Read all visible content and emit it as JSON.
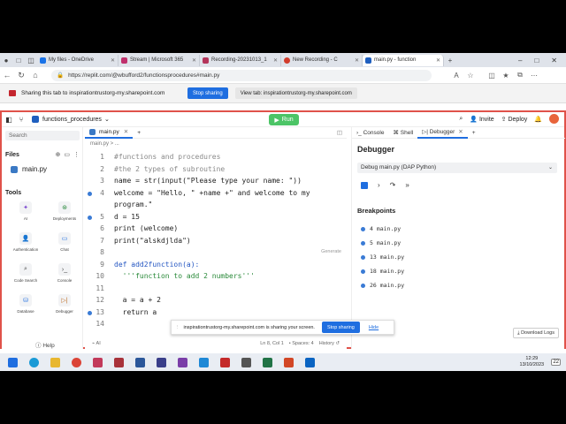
{
  "browser": {
    "tabs": [
      {
        "label": "My files - OneDrive",
        "color": "#1a73e8"
      },
      {
        "label": "Stream | Microsoft 365",
        "color": "#c0306c"
      },
      {
        "label": "Recording-20231013_1",
        "color": "#b4345a"
      },
      {
        "label": "New Recording - C",
        "color": "#d23c2c"
      },
      {
        "label": "main.py - function",
        "color": "#1f5fbf"
      }
    ],
    "url": "https://replit.com/@wbufford2/functionsprocedures#main.py"
  },
  "share_bar": {
    "message": "Sharing this tab to inspirationtrustorg-my.sharepoint.com",
    "stop_label": "Stop sharing",
    "view_label": "View tab: inspirationtrustorg-my.sharepoint.com"
  },
  "app": {
    "repo_name": "functions_procedures",
    "run_label": "Run",
    "invite_label": "Invite",
    "deploy_label": "Deploy",
    "search_placeholder": "Search",
    "files_label": "Files",
    "main_file": "main.py",
    "tools_label": "Tools",
    "tools": [
      "AI",
      "Deployments",
      "Authentication",
      "Chat",
      "Code Search",
      "Console",
      "Database",
      "Debugger"
    ],
    "help_label": "Help"
  },
  "editor": {
    "tab": "main.py",
    "breadcrumb": "main.py > ...",
    "generate_hint": "Generate",
    "lines": [
      {
        "n": "1",
        "text": "#functions and procedures",
        "type": "cmt",
        "bp": false
      },
      {
        "n": "2",
        "text": "#the 2 types of subroutine",
        "type": "cmt",
        "bp": false
      },
      {
        "n": "3",
        "text": "name = str(input(\"Please type your name: \"))",
        "type": "code",
        "bp": false
      },
      {
        "n": "4",
        "text": "welcome = \"Hello, \" +name +\" and welcome to my",
        "type": "code",
        "bp": true
      },
      {
        "n": "",
        "text": "program.\"",
        "type": "code",
        "bp": false
      },
      {
        "n": "5",
        "text": "d = 15",
        "type": "code",
        "bp": true
      },
      {
        "n": "6",
        "text": "print (welcome)",
        "type": "code",
        "bp": false
      },
      {
        "n": "7",
        "text": "print(\"alskdjlda\")",
        "type": "code",
        "bp": false
      },
      {
        "n": "8",
        "text": "",
        "type": "code",
        "bp": false
      },
      {
        "n": "9",
        "text": "def add2function(a):",
        "type": "kw",
        "bp": false
      },
      {
        "n": "10",
        "text": "  '''function to add 2 numbers'''",
        "type": "str",
        "bp": false
      },
      {
        "n": "11",
        "text": "",
        "type": "code",
        "bp": false
      },
      {
        "n": "12",
        "text": "  a = a + 2",
        "type": "code",
        "bp": false
      },
      {
        "n": "13",
        "text": "  return a",
        "type": "code",
        "bp": true
      },
      {
        "n": "14",
        "text": "",
        "type": "code",
        "bp": false
      }
    ],
    "ai_label": "AI",
    "status": {
      "position": "Ln 8, Col 1",
      "spaces": "Spaces: 4",
      "history": "History"
    }
  },
  "debugger": {
    "tabs": [
      "Console",
      "Shell",
      "Debugger"
    ],
    "title": "Debugger",
    "config": "Debug main.py (DAP Python)",
    "breakpoints_label": "Breakpoints",
    "breakpoints": [
      "4 main.py",
      "5 main.py",
      "13 main.py",
      "18 main.py",
      "26 main.py"
    ],
    "download_logs": "Download Logs"
  },
  "notification": {
    "message": "inspirationtrustorg-my.sharepoint.com is sharing your screen.",
    "stop_label": "Stop sharing",
    "hide_label": "Hide"
  },
  "taskbar": {
    "time": "12:29",
    "date": "13/10/2023",
    "badge": "22"
  }
}
